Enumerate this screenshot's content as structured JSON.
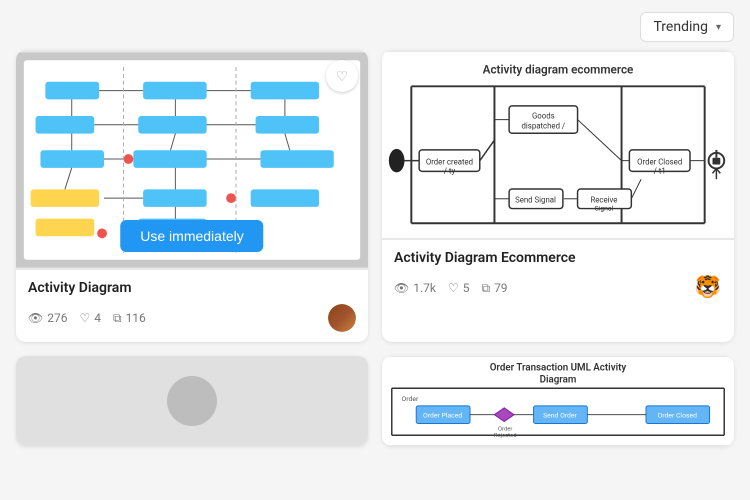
{
  "topbar": {
    "dropdown_label": "Trending",
    "chevron": "▾"
  },
  "cards": [
    {
      "id": "activity-diagram",
      "title": "Activity Diagram",
      "views": "276",
      "likes": "4",
      "copies": "116",
      "use_btn": "Use immediately",
      "avatar_type": "image"
    },
    {
      "id": "activity-diagram-ecommerce",
      "title": "Activity Diagram Ecommerce",
      "views": "1.7k",
      "likes": "5",
      "copies": "79",
      "avatar_type": "emoji",
      "avatar_emoji": "🐯"
    },
    {
      "id": "order-transaction-uml",
      "title": "Order Transaction UML Activity Diagram",
      "views": "",
      "likes": "",
      "copies": "",
      "avatar_type": "none"
    }
  ],
  "icons": {
    "eye": "👁",
    "heart": "♡",
    "copy": "⧉",
    "heart_filled": "♡",
    "chevron_down": "▾"
  }
}
